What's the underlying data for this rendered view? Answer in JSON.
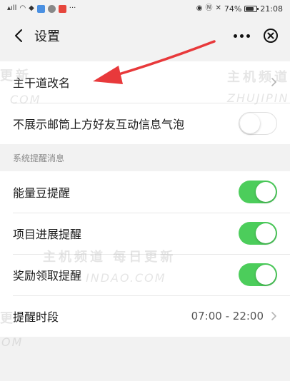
{
  "status_bar": {
    "battery": "74%",
    "battery_level": 0.74,
    "time": "21:08"
  },
  "nav": {
    "title": "设置",
    "back_icon": "chevron-left-icon",
    "more_icon": "more-dots-icon",
    "close_icon": "close-circle-icon"
  },
  "settings": {
    "rename": {
      "label": "主干道改名"
    },
    "hide_bubble": {
      "label": "不展示邮筒上方好友互动信息气泡",
      "on": false
    }
  },
  "reminders": {
    "header": "系统提醒消息",
    "items": [
      {
        "label": "能量豆提醒",
        "on": true
      },
      {
        "label": "项目进展提醒",
        "on": true
      },
      {
        "label": "奖励领取提醒",
        "on": true
      }
    ],
    "period": {
      "label": "提醒时段",
      "value": "07:00 - 22:00"
    }
  },
  "watermarks": {
    "cn": "主机频道",
    "cn_full": "主机频道 每日更新",
    "en": "ZHUJIPIN",
    "en2": "INDAO.COM",
    "en3": "COM",
    "en4": "OM",
    "cn_frag": "更新",
    "cn_frag2": "更"
  },
  "colors": {
    "toggle_on": "#4ccd5b",
    "annotation_arrow": "#e8393b",
    "background": "#f2f2f2"
  }
}
